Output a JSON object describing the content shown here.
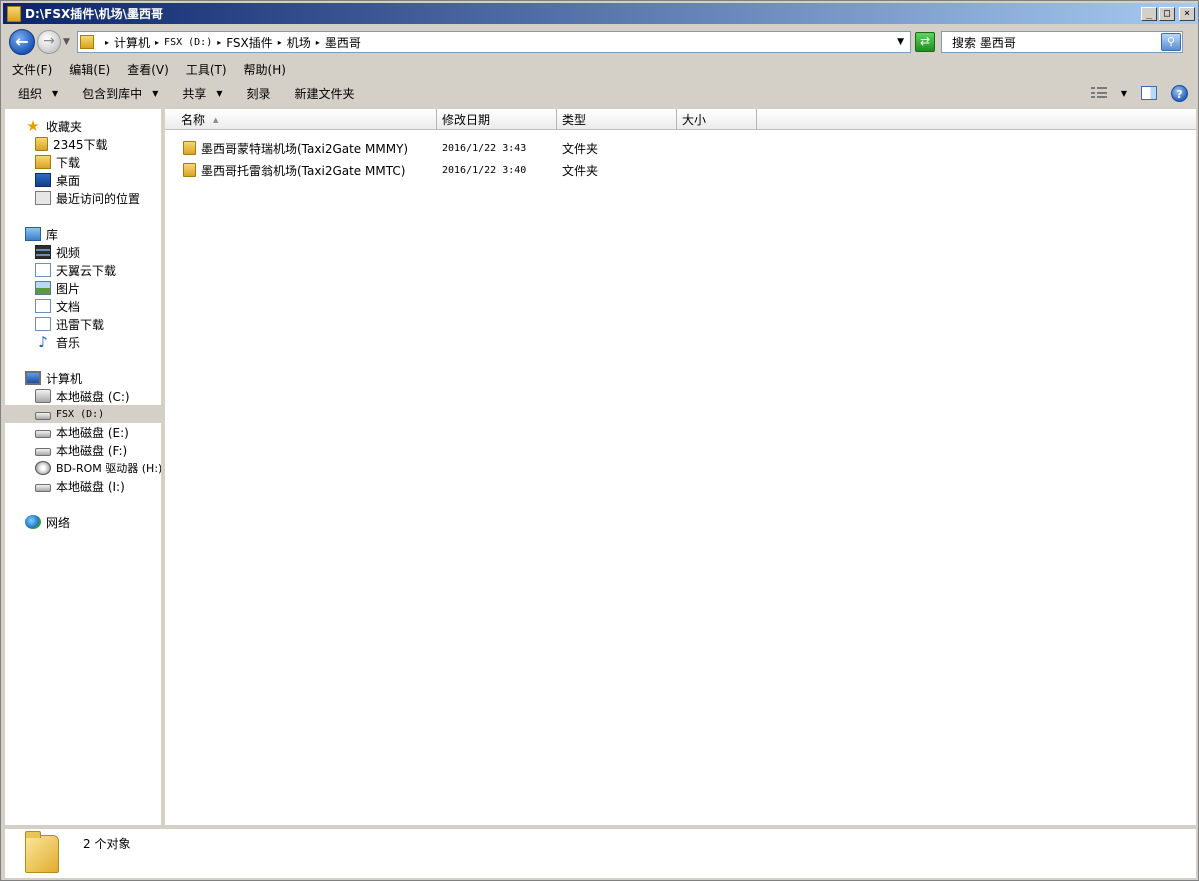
{
  "window": {
    "title": "D:\\FSX插件\\机场\\墨西哥",
    "buttons": {
      "minimize": "_",
      "maximize": "□",
      "close": "×"
    }
  },
  "address": {
    "crumbs": [
      "计算机",
      "FSX (D:)",
      "FSX插件",
      "机场",
      "墨西哥"
    ],
    "search_placeholder": "搜索 墨西哥"
  },
  "menu": [
    "文件(F)",
    "编辑(E)",
    "查看(V)",
    "工具(T)",
    "帮助(H)"
  ],
  "commands": {
    "organize": "组织",
    "include_library": "包含到库中",
    "share": "共享",
    "burn": "刻录",
    "new_folder": "新建文件夹"
  },
  "nav": {
    "favorites": {
      "label": "收藏夹",
      "items": [
        "2345下载",
        "下载",
        "桌面",
        "最近访问的位置"
      ]
    },
    "libraries": {
      "label": "库",
      "items": [
        "视频",
        "天翼云下载",
        "图片",
        "文档",
        "迅雷下载",
        "音乐"
      ]
    },
    "computer": {
      "label": "计算机",
      "items": [
        "本地磁盘 (C:)",
        "FSX (D:)",
        "本地磁盘 (E:)",
        "本地磁盘 (F:)",
        "BD-ROM 驱动器 (H:)",
        "本地磁盘 (I:)"
      ],
      "selected": "FSX (D:)"
    },
    "network": {
      "label": "网络"
    }
  },
  "columns": {
    "name": "名称",
    "date": "修改日期",
    "type": "类型",
    "size": "大小"
  },
  "files": [
    {
      "name": "墨西哥蒙特瑞机场(Taxi2Gate MMMY)",
      "date": "2016/1/22 3:43",
      "type": "文件夹"
    },
    {
      "name": "墨西哥托雷翁机场(Taxi2Gate MMTC)",
      "date": "2016/1/22 3:40",
      "type": "文件夹"
    }
  ],
  "details": {
    "count": "2 个对象"
  },
  "icons": {
    "nav_back": "arrow-left",
    "nav_forward": "arrow-right",
    "refresh": "refresh",
    "search": "magnifier",
    "help": "?"
  }
}
